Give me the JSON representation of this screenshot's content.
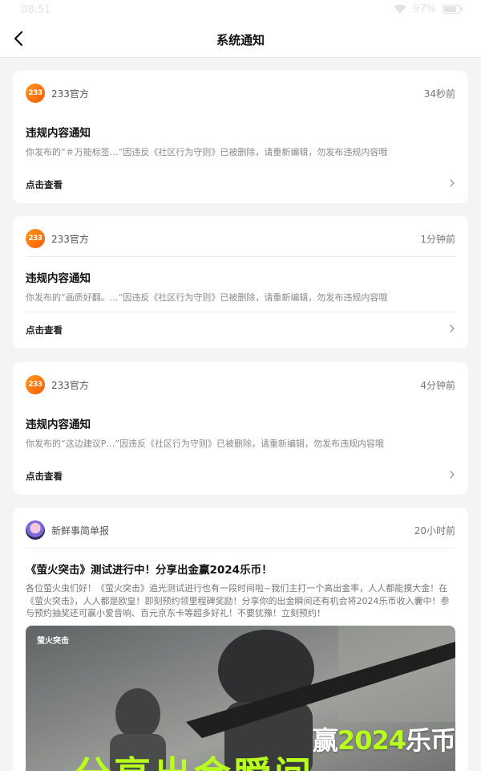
{
  "status_bar": {
    "time": "08:51",
    "battery": "97%"
  },
  "header": {
    "title": "系统通知"
  },
  "notices": [
    {
      "source": "233官方",
      "logo_text": "233",
      "time_ago": "34秒前",
      "title": "违规内容通知",
      "body": "你发布的“＃万能标签…”因违反《社区行为守则》已被删除，请重新编辑，勿发布违规内容哦",
      "action": "点击查看"
    },
    {
      "source": "233官方",
      "logo_text": "233",
      "time_ago": "1分钟前",
      "title": "违规内容通知",
      "body": "你发布的“画质好翻。…”因违反《社区行为守则》已被删除，请重新编辑，勿发布违规内容哦",
      "action": "点击查看"
    },
    {
      "source": "233官方",
      "logo_text": "233",
      "time_ago": "4分钟前",
      "title": "违规内容通知",
      "body": "你发布的“这边建议P…”因违反《社区行为守则》已被删除，请重新编辑，勿发布违规内容哦",
      "action": "点击查看"
    }
  ],
  "news": {
    "source": "新鲜事简单报",
    "time_ago": "20小时前",
    "title": "《萤火突击》测试进行中！分享出金赢2024乐币！",
    "body": "各位萤火虫们好！《萤火突击》追光测试进行也有一段时间啦~我们主打一个高出金率，人人都能摸大金！在《萤火突击》，人人都是欧皇！即刻预约领里程碑奖励！分享你的出金瞬间还有机会将2024乐币收入囊中！参与预约抽奖还可赢小爱音响、百元京东卡等超多好礼！不要犹豫！立刻预约！",
    "banner": {
      "logo": "萤火突击",
      "headline_prefix": "赢",
      "headline_highlight": "2024",
      "headline_suffix": "乐币",
      "slogan": "分享出金瞬间"
    }
  }
}
